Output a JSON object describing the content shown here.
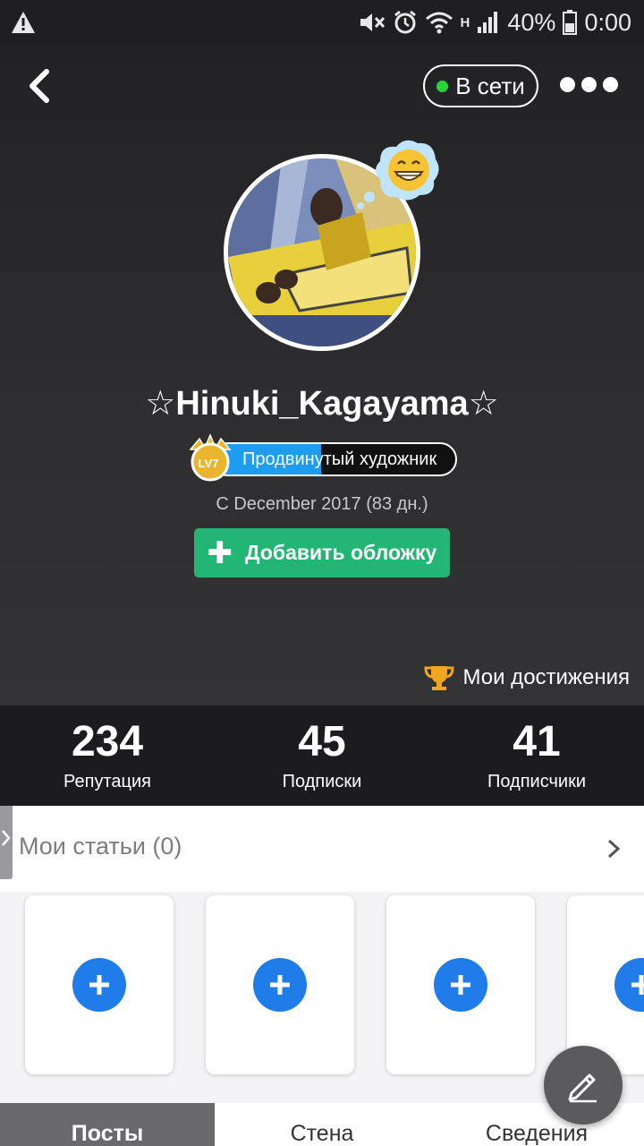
{
  "status_bar": {
    "battery": "40%",
    "time": "0:00",
    "network": "H",
    "icons": [
      "warning-icon",
      "mute-icon",
      "alarm-icon",
      "wifi-icon",
      "signal-icon",
      "battery-icon"
    ]
  },
  "header": {
    "back_icon": "chevron-left-icon",
    "status_label": "В сети",
    "status_color": "#28d43a",
    "more_icon": "more-dots-icon"
  },
  "profile": {
    "username": "☆Hinuki_Kagayama☆",
    "avatar_mood": "grinning-face-bubble",
    "level_text": "LV7",
    "level_title": "Продвинутый художник",
    "level_progress": 0.45,
    "since": "С December 2017 (83 дн.)",
    "add_cover_label": "Добавить обложку",
    "achievements_label": "Мои достижения"
  },
  "stats": [
    {
      "value": "234",
      "label": "Репутация"
    },
    {
      "value": "45",
      "label": "Подписки"
    },
    {
      "value": "41",
      "label": "Подписчики"
    }
  ],
  "articles": {
    "title": "Мои статьи (0)",
    "card_count": 4,
    "card_icon": "plus-circle-icon"
  },
  "tabs": [
    {
      "label": "Посты",
      "active": true
    },
    {
      "label": "Стена",
      "active": false
    },
    {
      "label": "Сведения",
      "active": false
    }
  ],
  "colors": {
    "accent_green": "#22b573",
    "accent_blue": "#1f7ce8",
    "level_blue": "#1e9df0"
  },
  "fab_icon": "pencil-icon"
}
